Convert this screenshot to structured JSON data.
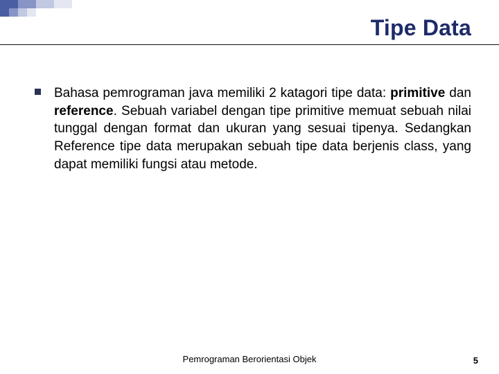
{
  "slide": {
    "title": "Tipe Data",
    "body": "Bahasa pemrograman java memiliki 2 katagori tipe data: primitive dan reference. Sebuah variabel dengan tipe primitive memuat sebuah nilai tunggal dengan format dan ukuran yang sesuai tipenya. Sedangkan Reference tipe data merupakan sebuah tipe data berjenis class, yang dapat memiliki fungsi atau metode.",
    "bold_terms": [
      "primitive",
      "reference"
    ],
    "footer": "Pemrograman Berorientasi Objek",
    "page_number": "5"
  }
}
